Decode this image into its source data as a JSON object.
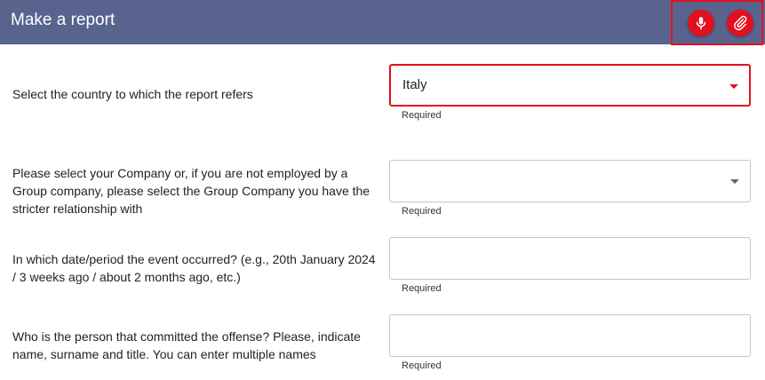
{
  "header": {
    "title": "Make a report",
    "mic_icon": "microphone-icon",
    "attach_icon": "paperclip-icon"
  },
  "colors": {
    "header_bg": "#58648e",
    "accent": "#e3101f"
  },
  "form": {
    "fields": [
      {
        "label": "Select the country to which the report refers",
        "value": "Italy",
        "helper": "Required",
        "type": "select"
      },
      {
        "label": "Please select your Company or, if you are not employed by a Group company, please select the Group Company you have the stricter relationship with",
        "value": "",
        "helper": "Required",
        "type": "select"
      },
      {
        "label": "In which date/period the event occurred? (e.g., 20th January 2024 / 3 weeks ago / about 2 months ago, etc.)",
        "value": "",
        "helper": "Required",
        "type": "text"
      },
      {
        "label": "Who is the person that committed the offense? Please, indicate name, surname and title. You can enter multiple names",
        "value": "",
        "helper": "Required",
        "type": "text"
      }
    ]
  }
}
